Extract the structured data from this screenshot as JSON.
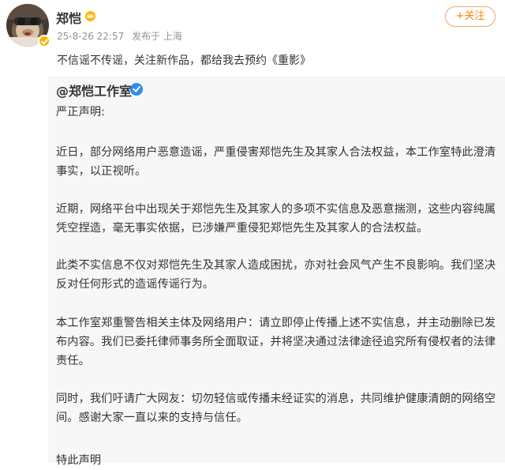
{
  "post": {
    "username": "郑恺",
    "crown_icon": "crown-icon",
    "date": "25-8-26 22:57",
    "source": "发布于 上海",
    "follow_label": "+关注",
    "text": "不信谣不传谣，关注新作品，都给我去预约《重影》",
    "accent_color": "#ff8200"
  },
  "repost": {
    "author": "@郑恺工作室",
    "verified_icon": "blue-v-icon",
    "paragraphs": [
      "严正声明:",
      "近日，部分网络用户恶意造谣，严重侵害郑恺先生及其家人合法权益，本工作室特此澄清事实，以正视听。",
      "近期，网络平台中出现关于郑恺先生及其家人的多项不实信息及恶意揣测，这些内容纯属凭空捏造，毫无事实依据，已涉嫌严重侵犯郑恺先生及其家人的合法权益。",
      "此类不实信息不仅对郑恺先生及其家人造成困扰，亦对社会风气产生不良影响。我们坚决反对任何形式的造谣传谣行为。",
      "本工作室郑重警告相关主体及网络用户：请立即停止传播上述不实信息，并主动删除已发布内容。我们已委托律师事务所全面取证，并将坚决通过法律途径追究所有侵权者的法律责任。",
      "同时，我们吁请广大网友：切勿轻信或传播未经证实的消息，共同维护健康清朗的网络空间。感谢大家一直以来的支持与信任。",
      "特此声明"
    ]
  }
}
